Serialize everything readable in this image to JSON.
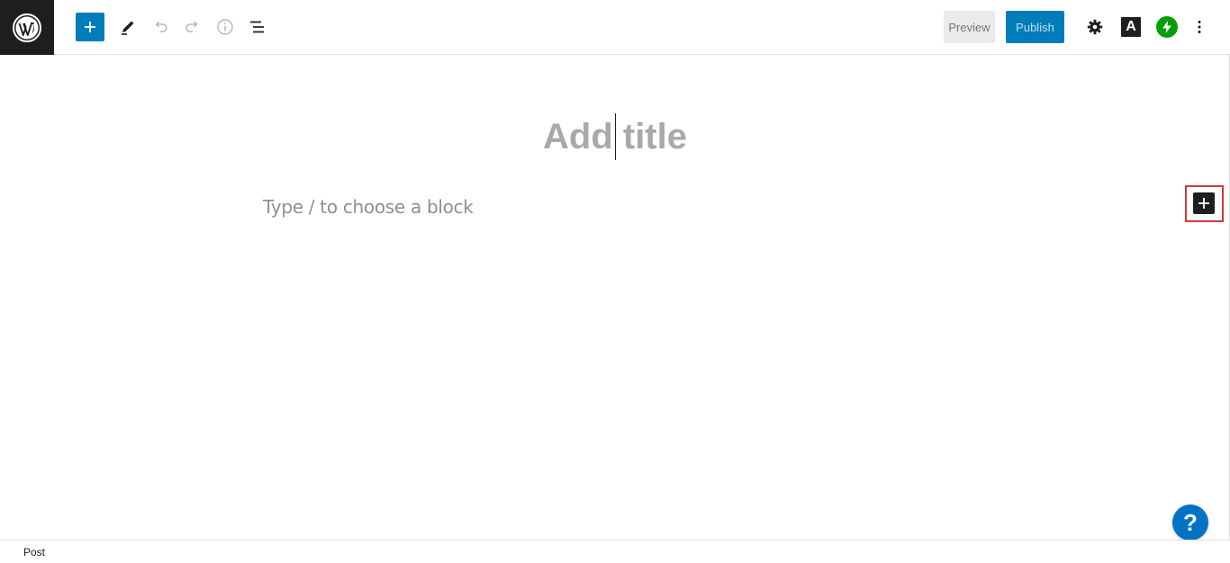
{
  "toolbar": {
    "logo_icon": "wordpress-logo-icon",
    "inserter_icon": "plus-icon",
    "tools_icon": "pencil-icon",
    "undo_icon": "undo-icon",
    "redo_icon": "redo-icon",
    "details_icon": "info-icon",
    "list_view_icon": "list-view-icon",
    "preview_label": "Preview",
    "publish_label": "Publish",
    "settings_icon": "gear-icon",
    "typography_letter": "A",
    "jetpack_icon": "jetpack-bolt-icon",
    "more_icon": "vertical-ellipsis-icon"
  },
  "editor": {
    "title_placeholder": "Add title",
    "block_placeholder": "Type / to choose a block",
    "side_inserter_icon": "plus-icon"
  },
  "help": {
    "label": "?"
  },
  "footer": {
    "breadcrumb": "Post"
  },
  "colors": {
    "accent": "#007cba",
    "dark": "#1e1e1e",
    "highlight_frame": "#d63638",
    "jetpack": "#069e08",
    "help": "#0073c4"
  }
}
